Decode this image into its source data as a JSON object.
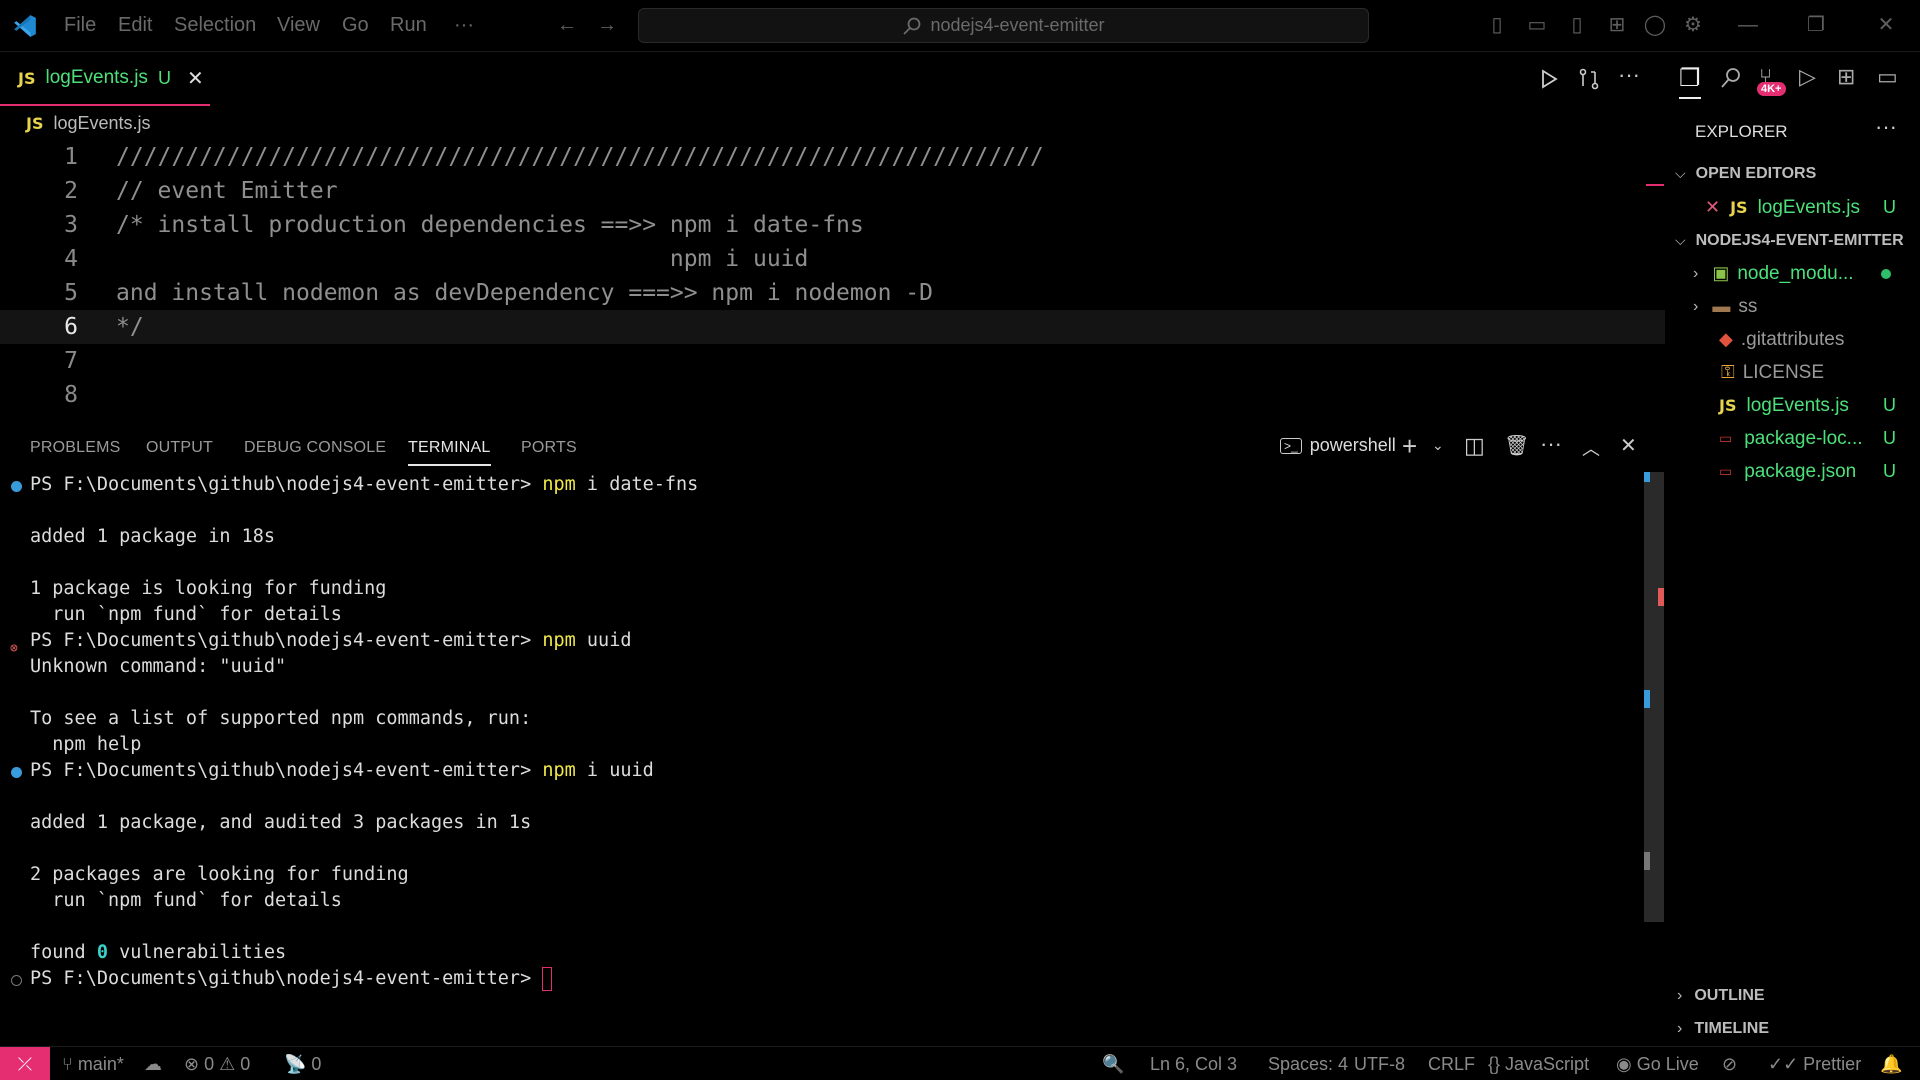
{
  "menu": [
    "File",
    "Edit",
    "Selection",
    "View",
    "Go",
    "Run",
    "···"
  ],
  "search": {
    "text": "nodejs4-event-emitter"
  },
  "tab": {
    "badge": "JS",
    "name": "logEvents.js",
    "status": "U",
    "close": "✕"
  },
  "breadcrumb": {
    "badge": "JS",
    "file": "logEvents.js"
  },
  "editor": {
    "lines": [
      {
        "num": "1",
        "code": "///////////////////////////////////////////////////////////////////"
      },
      {
        "num": "2",
        "code": "// event Emitter"
      },
      {
        "num": "3",
        "code": "/* install production dependencies ==>> npm i date-fns"
      },
      {
        "num": "4",
        "code": "                                        npm i uuid"
      },
      {
        "num": "5",
        "code": "and install nodemon as devDependency ===>> npm i nodemon -D"
      },
      {
        "num": "6",
        "code": "*/"
      },
      {
        "num": "7",
        "code": ""
      },
      {
        "num": "8",
        "code": ""
      }
    ]
  },
  "panel": {
    "tabs": [
      "PROBLEMS",
      "OUTPUT",
      "DEBUG CONSOLE",
      "TERMINAL",
      "PORTS"
    ],
    "shell": "powershell"
  },
  "terminal": {
    "prompt": "PS F:\\Documents\\github\\nodejs4-event-emitter> ",
    "cmd1_a": "npm",
    "cmd1_b": " i date-fns",
    "out1": "added 1 package in 18s",
    "out2": "1 package is looking for funding",
    "out3": "  run `npm fund` for details",
    "cmd2_a": "npm",
    "cmd2_b": " uuid",
    "out4": "Unknown command: \"uuid\"",
    "out5": "To see a list of supported npm commands, run:",
    "out6": "  npm help",
    "cmd3_a": "npm",
    "cmd3_b": " i uuid",
    "out7": "added 1 package, and audited 3 packages in 1s",
    "out8": "2 packages are looking for funding",
    "out9": "  run `npm fund` for details",
    "out10a": "found ",
    "out10b": "0",
    "out10c": " vulnerabilities"
  },
  "sidebar": {
    "title": "EXPLORER",
    "more": "···",
    "badge": "4K+",
    "open_editors": "OPEN EDITORS",
    "open_file": {
      "badge": "JS",
      "name": "logEvents.js",
      "status": "U"
    },
    "project": "NODEJS4-EVENT-EMITTER",
    "items": [
      {
        "name": "node_modu...",
        "status": ""
      },
      {
        "name": "ss",
        "status": ""
      },
      {
        "name": ".gitattributes",
        "status": ""
      },
      {
        "name": "LICENSE",
        "status": ""
      },
      {
        "name": "logEvents.js",
        "status": "U"
      },
      {
        "name": "package-loc...",
        "status": "U"
      },
      {
        "name": "package.json",
        "status": "U"
      }
    ],
    "outline": "OUTLINE",
    "timeline": "TIMELINE"
  },
  "status": {
    "branch": "main*",
    "errors": "0",
    "warnings": "0",
    "ports": "0",
    "position": "Ln 6, Col 3",
    "spaces": "Spaces: 4",
    "encoding": "UTF-8",
    "eol": "CRLF",
    "language": "JavaScript",
    "golive": "Go Live",
    "prettier": "Prettier"
  },
  "colors": {
    "accent": "#e52e72",
    "green": "#4ce07a",
    "yellow": "#f0e94a",
    "js": "#e8d44d"
  }
}
